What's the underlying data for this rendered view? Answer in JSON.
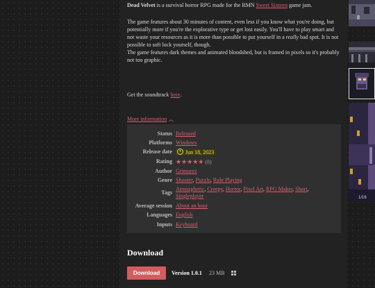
{
  "description": {
    "game_title": "Dead Velvet",
    "intro_text": " is a survival horror RPG made for the RMN ",
    "jam_link": "Sweet Sixteen",
    "intro_end": " game jam.",
    "para1_a": "The game features about 30 minutes of content, even less if you know what you're doing, but potentially more if you're the explorative type or get lost easily. You'll have to play smart and not waste your resources as it is more than possible to put yourself in a ",
    "para1_em": "really",
    "para1_b": " bad spot. It is not possible to soft lock yourself, though.",
    "para2": "The game features dark themes and animated bloodshed, but is framed in pixels so it's probably not too graphic.",
    "soundtrack_text": "Get the soundtrack ",
    "soundtrack_link": "here",
    "soundtrack_end": "."
  },
  "more_info": {
    "label": "More information"
  },
  "info": {
    "status": {
      "label": "Status",
      "value": "Released"
    },
    "platforms": {
      "label": "Platforms",
      "value": "Windows"
    },
    "release_date": {
      "label": "Release date",
      "value": "Jun 18, 2023"
    },
    "rating": {
      "label": "Rating",
      "stars": "★★★★★",
      "count": "(8)",
      "value": 5
    },
    "author": {
      "label": "Author",
      "value": "Grimurez"
    },
    "genre": {
      "label": "Genre",
      "values": [
        "Shooter",
        "Puzzle",
        "Role Playing"
      ]
    },
    "tags": {
      "label": "Tags",
      "values": [
        "Atmospheric",
        "Creepy",
        "Horror",
        "Pixel Art",
        "RPG Maker",
        "Short",
        "Singleplayer"
      ]
    },
    "average_session": {
      "label": "Average session",
      "value": "About an hour"
    },
    "languages": {
      "label": "Languages",
      "value": "English"
    },
    "inputs": {
      "label": "Inputs",
      "value": "Keyboard"
    }
  },
  "download": {
    "heading": "Download",
    "button_label": "Download",
    "version": "Version 1.0.1",
    "size": "23 MB",
    "platform_icon": "windows-icon"
  },
  "screenshots": {
    "counter": "1/16"
  },
  "colors": {
    "link": "#e05f6f",
    "button": "#d25c5e",
    "panel": "#303030",
    "highlight": "#f0e44a"
  }
}
